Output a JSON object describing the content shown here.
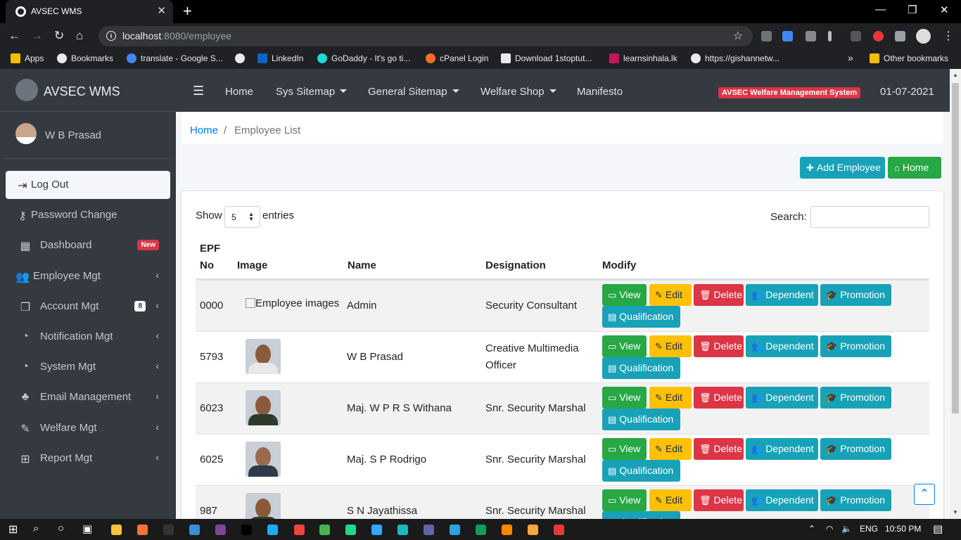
{
  "browser": {
    "tab_title": "AVSEC WMS",
    "tab_close": "✕",
    "new_tab": "+",
    "url_host": "localhost",
    "url_path": ":8080/employee",
    "bookmarks": [
      {
        "label": "Apps",
        "color": "#fbbc04"
      },
      {
        "label": "Bookmarks",
        "color": "#e8eaed"
      },
      {
        "label": "translate - Google S...",
        "color": "#4285f4"
      },
      {
        "label": "",
        "color": "#e8eaed"
      },
      {
        "label": "LinkedIn",
        "color": "#0a66c2"
      },
      {
        "label": "GoDaddy - It's go ti...",
        "color": "#1bdbdb"
      },
      {
        "label": "cPanel Login",
        "color": "#ff6c2c"
      },
      {
        "label": "Download 1stoptut...",
        "color": "#e8eaed"
      },
      {
        "label": "learnsinhala.lk",
        "color": "#c2185b"
      },
      {
        "label": "https://gishannetw...",
        "color": "#e8eaed"
      },
      {
        "label": "»",
        "color": ""
      },
      {
        "label": "Other bookmarks",
        "color": "#fbbc04"
      }
    ]
  },
  "brand": {
    "name": "AVSEC WMS"
  },
  "user": {
    "name": "W B Prasad"
  },
  "sidebar": {
    "items": [
      {
        "label": "Log Out",
        "icon": "sign-out-icon",
        "glyph": "⇥",
        "active": true
      },
      {
        "label": "Password Change",
        "icon": "key-icon",
        "glyph": "⚷"
      },
      {
        "label": "Dashboard",
        "icon": "th-icon",
        "glyph": "▦",
        "badge": "New"
      },
      {
        "label": "Employee Mgt",
        "icon": "users-icon",
        "glyph": "👥",
        "arrow": "‹"
      },
      {
        "label": "Account Mgt",
        "icon": "copy-icon",
        "glyph": "❐",
        "count": "8",
        "arrow": "‹"
      },
      {
        "label": "Notification Mgt",
        "icon": "chart-pie-icon",
        "glyph": "◔",
        "arrow": "‹"
      },
      {
        "label": "System Mgt",
        "icon": "chart-pie-icon",
        "glyph": "◔",
        "arrow": "‹"
      },
      {
        "label": "Email Management",
        "icon": "tree-icon",
        "glyph": "♣",
        "arrow": "‹"
      },
      {
        "label": "Welfare Mgt",
        "icon": "edit-icon",
        "glyph": "✎",
        "arrow": "‹"
      },
      {
        "label": "Report Mgt",
        "icon": "table-icon",
        "glyph": "⊞",
        "arrow": "‹"
      }
    ]
  },
  "topnav": {
    "menu_glyph": "☰",
    "items": [
      {
        "label": "Home",
        "dropdown": false
      },
      {
        "label": "Sys Sitemap",
        "dropdown": true
      },
      {
        "label": "General Sitemap",
        "dropdown": true
      },
      {
        "label": "Welfare Shop",
        "dropdown": true
      },
      {
        "label": "Manifesto",
        "dropdown": false
      }
    ],
    "system_badge": "AVSEC Welfare Management System",
    "date": "01-07-2021"
  },
  "breadcrumb": {
    "home": "Home",
    "separator": "/",
    "current": "Employee List"
  },
  "actions": {
    "add_employee": "Add Employee",
    "home": "Home"
  },
  "table_controls": {
    "show": "Show",
    "length": "5",
    "entries": "entries",
    "search_label": "Search:"
  },
  "table": {
    "headers": {
      "epf_line1": "EPF",
      "epf_line2": "No",
      "image": "Image",
      "name": "Name",
      "designation": "Designation",
      "modify": "Modify"
    },
    "broken_image_alt": "Employee images",
    "buttons": {
      "view": "View",
      "edit": "Edit",
      "delete": "Delete",
      "dependent": "Dependent",
      "promotion": "Promotion",
      "qualification": "Qualification"
    },
    "rows": [
      {
        "epf": "0000",
        "name": "Admin",
        "designation": "Security Consultant",
        "has_image": false
      },
      {
        "epf": "5793",
        "name": "W B Prasad",
        "designation": "Creative Multimedia Officer",
        "has_image": true
      },
      {
        "epf": "6023",
        "name": "Maj. W P R S Withana",
        "designation": "Snr. Security Marshal",
        "has_image": true
      },
      {
        "epf": "6025",
        "name": "Maj. S P Rodrigo",
        "designation": "Snr. Security Marshal",
        "has_image": true
      },
      {
        "epf": "987",
        "name": "S N Jayathissa",
        "designation": "Snr. Security Marshal",
        "has_image": true
      }
    ]
  },
  "taskbar": {
    "lang": "ENG",
    "time": "10:50 PM",
    "apps": [
      {
        "name": "file-explorer-icon",
        "color": "#f9c23c"
      },
      {
        "name": "firefox-icon",
        "color": "#ff7139"
      },
      {
        "name": "terminal-icon",
        "color": "#333333"
      },
      {
        "name": "remote-desktop-icon",
        "color": "#3b8ed4"
      },
      {
        "name": "tor-icon",
        "color": "#7d4698"
      },
      {
        "name": "intellij-icon",
        "color": "#000000"
      },
      {
        "name": "vscode-icon",
        "color": "#23a9f2"
      },
      {
        "name": "anydesk-icon",
        "color": "#ef443b"
      },
      {
        "name": "chrome-icon",
        "color": "#4caf50"
      },
      {
        "name": "pycharm-icon",
        "color": "#21d789"
      },
      {
        "name": "photoshop-icon",
        "color": "#31a8ff"
      },
      {
        "name": "app-circle-icon",
        "color": "#1fb6c1"
      },
      {
        "name": "teams-icon",
        "color": "#6264a7"
      },
      {
        "name": "telegram-icon",
        "color": "#2aa3df"
      },
      {
        "name": "sheets-icon",
        "color": "#0f9d58"
      },
      {
        "name": "vlc-icon",
        "color": "#ff8800"
      },
      {
        "name": "window-app-icon",
        "color": "#f4a742"
      },
      {
        "name": "record-icon",
        "color": "#e53935"
      }
    ]
  }
}
